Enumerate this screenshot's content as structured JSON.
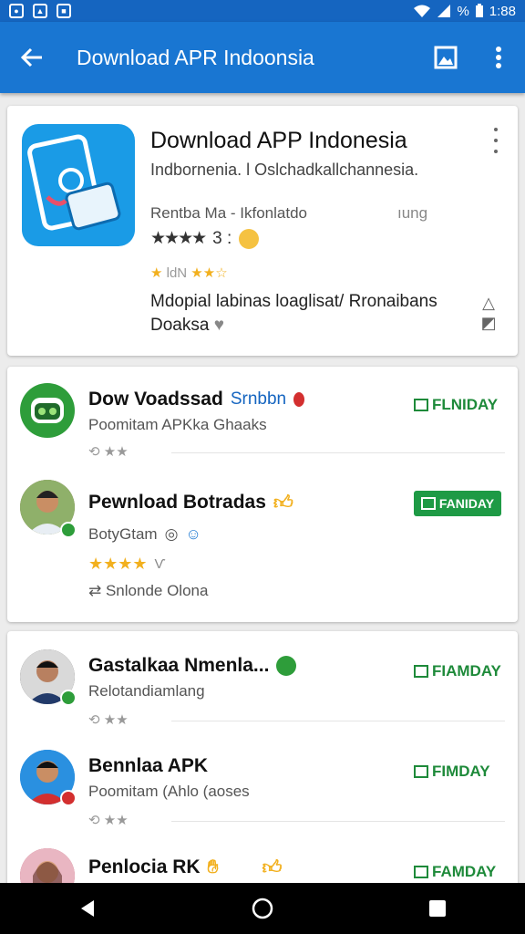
{
  "status_bar": {
    "time": "1:88",
    "battery": "%"
  },
  "app_bar": {
    "title": "Download APR Indoonsia"
  },
  "featured": {
    "title": "Download APP Indonesia",
    "subtitle": "Indbornenia. l Oslchadkallchannesia.",
    "developer": "Rentba Ma -  Ikfonlatdo",
    "developer_extra": "ıung",
    "rating_text": "3 :",
    "small_rating_text": "ldN",
    "description_line1": "Mdopial labinas loaglisat/ Rronaibans",
    "description_line2": "Doaksa"
  },
  "list_group_1": [
    {
      "title": "Dow Voadssad",
      "tag": "Srnbbn",
      "subtitle": "Poomitam APKka Ghaaks",
      "meta": "★★",
      "install": "FLNIDAY",
      "avatar_color": "#2e9d3a"
    },
    {
      "title": "Pewnload Botradas",
      "subtitle": "BotyGtam",
      "rating_suffix": "Ѵ",
      "extra": "Snlonde Olona",
      "install": "FANIDAY",
      "avatar_color": "#7a5a40"
    }
  ],
  "list_group_2": [
    {
      "title": "Gastalkaa Nmenla...",
      "subtitle": "Relotandiamlang",
      "meta": "★★",
      "install": "FIAMDAY",
      "avatar_color": "#3a3a3a"
    },
    {
      "title": "Bennlaa APK",
      "subtitle": "Poomitam (Ahlo (aoses",
      "meta": "★★",
      "install": "FIMDAY",
      "avatar_color": "#1e88e5"
    },
    {
      "title": "Penlocia RK",
      "subtitle": "",
      "install": "FAMDAY",
      "avatar_color": "#c0506a"
    }
  ],
  "colors": {
    "primary": "#1976d2",
    "status": "#1565c0",
    "install_green": "#1e8a3a",
    "star": "#f2b01e"
  }
}
